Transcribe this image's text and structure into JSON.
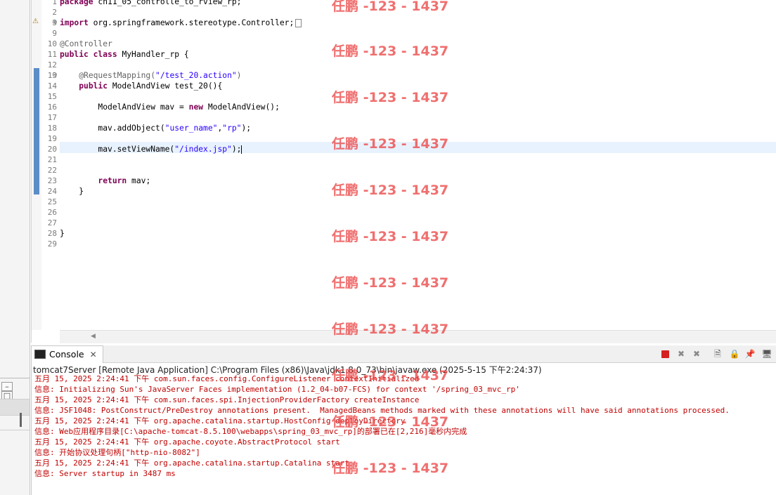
{
  "editor": {
    "lines": [
      {
        "n": "1",
        "html": "<span class='kw'>package</span> ch11_05_controlle_to_rview_rp;"
      },
      {
        "n": "2",
        "html": ""
      },
      {
        "n": "3",
        "html": "<span class='kw'>import</span> org.springframework.stereotype.Controller;"
      },
      {
        "n": "9",
        "html": ""
      },
      {
        "n": "10",
        "html": "<span class='ann'>@Controller</span>"
      },
      {
        "n": "11",
        "html": "<span class='kw'>public</span> <span class='kw'>class</span> MyHandler_rp {"
      },
      {
        "n": "12",
        "html": ""
      },
      {
        "n": "13",
        "html": "    <span class='ann'>@RequestMapping(</span><span class='str'>\"/test_20.action\"</span><span class='ann'>)</span>"
      },
      {
        "n": "14",
        "html": "    <span class='kw'>public</span> ModelAndView test_20(){"
      },
      {
        "n": "15",
        "html": ""
      },
      {
        "n": "16",
        "html": "        ModelAndView mav = <span class='kw'>new</span> ModelAndView();"
      },
      {
        "n": "17",
        "html": ""
      },
      {
        "n": "18",
        "html": "        mav.addObject(<span class='str'>\"user_name\"</span>,<span class='str'>\"rp\"</span>);"
      },
      {
        "n": "19",
        "html": ""
      },
      {
        "n": "20",
        "html": "        mav.setViewName(<span class='str'>\"/index.jsp\"</span>);<span class='caret'></span>"
      },
      {
        "n": "21",
        "html": ""
      },
      {
        "n": "22",
        "html": ""
      },
      {
        "n": "23",
        "html": "        <span class='kw'>return</span> mav;"
      },
      {
        "n": "24",
        "html": "    }"
      },
      {
        "n": "25",
        "html": ""
      },
      {
        "n": "26",
        "html": ""
      },
      {
        "n": "27",
        "html": ""
      },
      {
        "n": "28",
        "html": "}"
      },
      {
        "n": "29",
        "html": ""
      }
    ]
  },
  "console": {
    "tab_label": "Console",
    "close_glyph": "✕",
    "launch_title": "tomcat7Server [Remote Java Application] C:\\Program Files (x86)\\Java\\jdk1.8.0_73\\bin\\javaw.exe (2025-5-15 下午2:24:37)",
    "toolbar": {
      "remove_all": "✖",
      "remove_launch": "✖",
      "clear": "🗎",
      "scroll_lock": "🔒",
      "pin": "📌",
      "display": "🖥"
    },
    "output": [
      {
        "text": "五月 15, 2025 2:24:41 下午 com.sun.faces.config.ConfigureListener contextInitialized",
        "red": true
      },
      {
        "text": "信息: Initializing Sun's JavaServer Faces implementation (1.2_04-b07-FCS) for context '/spring_03_mvc_rp'",
        "red": true
      },
      {
        "text": "五月 15, 2025 2:24:41 下午 com.sun.faces.spi.InjectionProviderFactory createInstance",
        "red": true
      },
      {
        "text": "信息: JSF1048: PostConstruct/PreDestroy annotations present.  ManagedBeans methods marked with these annotations will have said annotations processed.",
        "red": true
      },
      {
        "text": "五月 15, 2025 2:24:41 下午 org.apache.catalina.startup.HostConfig deployDirectory",
        "red": true
      },
      {
        "text": "信息: Web应用程序目录[C:\\apache-tomcat-8.5.100\\webapps\\spring_03_mvc_rp]的部署已在[2,216]毫秒内完成",
        "red": true
      },
      {
        "text": "五月 15, 2025 2:24:41 下午 org.apache.coyote.AbstractProtocol start",
        "red": true
      },
      {
        "text": "信息: 开始协议处理句柄[\"http-nio-8082\"]",
        "red": true
      },
      {
        "text": "五月 15, 2025 2:24:41 下午 org.apache.catalina.startup.Catalina start",
        "red": true
      },
      {
        "text": "信息: Server startup in 3487 ms",
        "red": true
      }
    ]
  },
  "watermark": "任鹏 -123 - 1437",
  "colors": {
    "keyword": "#7f0055",
    "string": "#2a00ff",
    "annotation": "#646464",
    "watermark": "#ec4646",
    "change_bar": "#5b8dc6",
    "current_line": "#e8f2fe"
  }
}
